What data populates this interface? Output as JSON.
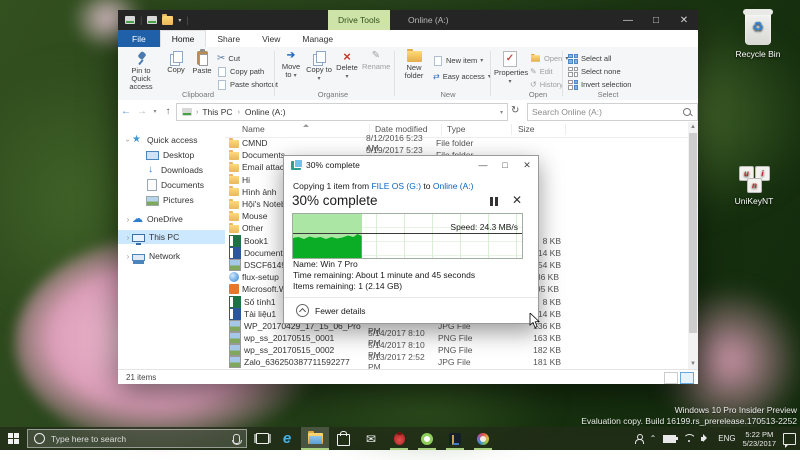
{
  "colors": {
    "titlebar": "#252525",
    "file_tab_blue": "#2060a8",
    "drive_tools_green": "#cde3a7",
    "ribbon_bg": "#f5f6f7",
    "selection_blue": "#cce8ff",
    "link_blue": "#0a64c0",
    "progress_light": "#ace6a4",
    "progress_dark": "#0cad26",
    "taskbar_underline": "#a8d080"
  },
  "explorer": {
    "title": "Online (A:)",
    "contextual_tab": "Drive Tools",
    "tabs": [
      "File",
      "Home",
      "Share",
      "View",
      "Manage"
    ],
    "ribbon": {
      "pin_to_quick_access": "Pin to Quick access",
      "copy": "Copy",
      "paste": "Paste",
      "cut": "Cut",
      "copy_path": "Copy path",
      "paste_shortcut": "Paste shortcut",
      "group_clipboard": "Clipboard",
      "move_to": "Move to",
      "copy_to": "Copy to",
      "delete": "Delete",
      "rename": "Rename",
      "group_organise": "Organise",
      "new_folder": "New folder",
      "new_item": "New item",
      "easy_access": "Easy access",
      "group_new": "New",
      "properties": "Properties",
      "open": "Open",
      "edit": "Edit",
      "history": "History",
      "group_open": "Open",
      "select_all": "Select all",
      "select_none": "Select none",
      "invert_selection": "Invert selection",
      "group_select": "Select"
    },
    "address": {
      "crumb_root": "This PC",
      "crumb_current": "Online (A:)",
      "search_placeholder": "Search Online (A:)"
    },
    "sidebar": [
      {
        "label": "Quick access",
        "icon": "star",
        "indent": 0,
        "chevron": "down"
      },
      {
        "label": "Desktop",
        "icon": "desktop",
        "indent": 1,
        "pinned": true
      },
      {
        "label": "Downloads",
        "icon": "downloads",
        "indent": 1,
        "pinned": true
      },
      {
        "label": "Documents",
        "icon": "documents",
        "indent": 1,
        "pinned": true
      },
      {
        "label": "Pictures",
        "icon": "pictures",
        "indent": 1,
        "pinned": true
      },
      {
        "label": "OneDrive",
        "icon": "onedrive",
        "indent": 0,
        "chevron": "right"
      },
      {
        "label": "This PC",
        "icon": "thispc",
        "indent": 0,
        "chevron": "right",
        "selected": true
      },
      {
        "label": "Network",
        "icon": "network",
        "indent": 0,
        "chevron": "right"
      }
    ],
    "columns": {
      "name": "Name",
      "date": "Date modified",
      "type": "Type",
      "size": "Size"
    },
    "files": [
      {
        "name": "CMND",
        "icon": "folder",
        "date": "8/12/2016 5:23 AM",
        "type": "File folder",
        "size": ""
      },
      {
        "name": "Documents",
        "icon": "folder",
        "date": "5/19/2017 5:23 AM",
        "type": "File folder",
        "size": ""
      },
      {
        "name": "Email attach",
        "icon": "folder",
        "date": "",
        "type": "",
        "size": ""
      },
      {
        "name": "Hi",
        "icon": "folder",
        "date": "",
        "type": "",
        "size": ""
      },
      {
        "name": "Hình ảnh",
        "icon": "folder",
        "date": "",
        "type": "",
        "size": ""
      },
      {
        "name": "Hội's Noteb",
        "icon": "folder",
        "date": "",
        "type": "",
        "size": ""
      },
      {
        "name": "Mouse",
        "icon": "folder",
        "date": "",
        "type": "",
        "size": ""
      },
      {
        "name": "Other",
        "icon": "folder",
        "date": "",
        "type": "",
        "size": ""
      },
      {
        "name": "Book1",
        "icon": "excel",
        "date": "",
        "type": "",
        "size": "8 KB"
      },
      {
        "name": "Document1",
        "icon": "word",
        "date": "",
        "type": "",
        "size": "14 KB"
      },
      {
        "name": "DSCF6149",
        "icon": "image",
        "date": "",
        "type": "",
        "size": "54 KB"
      },
      {
        "name": "flux-setup",
        "icon": "globe",
        "date": "",
        "type": "",
        "size": "486 KB"
      },
      {
        "name": "Microsoft.W",
        "icon": "app",
        "date": "",
        "type": "",
        "size": "795 KB"
      },
      {
        "name": "Số tính1",
        "icon": "excel",
        "date": "",
        "type": "",
        "size": "8 KB"
      },
      {
        "name": "Tài liệu1",
        "icon": "word",
        "date": "",
        "type": "",
        "size": "14 KB"
      },
      {
        "name": "WP_20170429_17_15_06_Pro",
        "icon": "image",
        "date": "5/14/2017 8:10 PM",
        "type": "JPG File",
        "size": "136 KB"
      },
      {
        "name": "wp_ss_20170515_0001",
        "icon": "image",
        "date": "5/14/2017 8:10 PM",
        "type": "PNG File",
        "size": "163 KB"
      },
      {
        "name": "wp_ss_20170515_0002",
        "icon": "image",
        "date": "5/14/2017 8:10 PM",
        "type": "PNG File",
        "size": "182 KB"
      },
      {
        "name": "Zalo_636250387711592277",
        "icon": "image",
        "date": "3/13/2017 2:52 PM",
        "type": "JPG File",
        "size": "181 KB"
      }
    ],
    "status": "21 items"
  },
  "dialog": {
    "title": "30% complete",
    "copy_prefix": "Copying 1 item from",
    "source": "FILE OS (G:)",
    "connector": "to",
    "destination": "Online (A:)",
    "heading": "30% complete",
    "progress_percent": 30,
    "speed_label": "Speed: 24.3 MB/s",
    "name_line": "Name: Win 7 Pro",
    "time_line": "Time remaining: About 1 minute and 45 seconds",
    "items_line": "Items remaining: 1 (2.14 GB)",
    "fewer_details": "Fewer details"
  },
  "desktop": {
    "icons": [
      {
        "label": "Recycle Bin"
      },
      {
        "label": "UniKeyNT"
      }
    ]
  },
  "taskbar": {
    "search_placeholder": "Type here to search",
    "language": "ENG",
    "time": "5:22 PM",
    "date": "5/23/2017"
  },
  "watermark": {
    "line1": "Windows 10 Pro Insider Preview",
    "line2": "Evaluation copy. Build 16199.rs_prerelease.170513-2252"
  }
}
